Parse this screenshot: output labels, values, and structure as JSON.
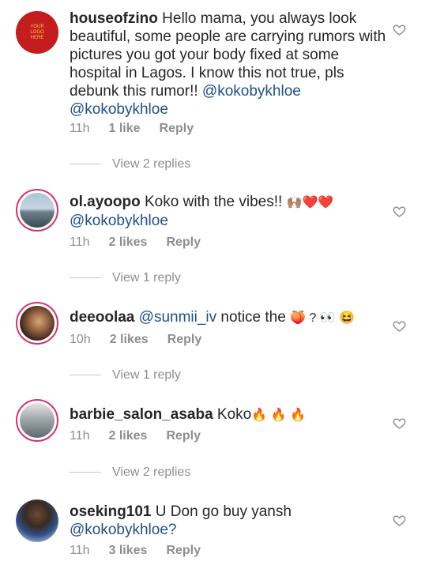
{
  "comments": [
    {
      "username": "houseofzino",
      "text": " Hello mama, you always look beautiful, some people are carrying rumors with pictures you got your body fixed at some hospital in Lagos. I know this not true, pls debunk this rumor!! ",
      "mention1": "@kokobykhloe",
      "mention2": "@kokobykhloe",
      "time": "11h",
      "likes": "1 like",
      "reply": "Reply",
      "view_replies": "View 2 replies",
      "avatar_text": "YOUR LOGO HERE"
    },
    {
      "username": "ol.ayoopo",
      "text": " Koko with the vibes!! ",
      "emoji": "🙌🏽❤️❤️",
      "mention": "@kokobykhloe",
      "time": "11h",
      "likes": "2 likes",
      "reply": "Reply",
      "view_replies": "View 1 reply"
    },
    {
      "username": "deeoolaa",
      "mention": "@sunmii_iv",
      "text": " notice the ",
      "emoji": "🍑 ? 👀 😆",
      "time": "10h",
      "likes": "2 likes",
      "reply": "Reply",
      "view_replies": "View 1 reply"
    },
    {
      "username": "barbie_salon_asaba",
      "text": " Koko",
      "emoji": "🔥 🔥 🔥",
      "time": "11h",
      "likes": "2 likes",
      "reply": "Reply",
      "view_replies": "View 2 replies"
    },
    {
      "username": "oseking101",
      "text": " U Don go buy yansh ",
      "mention": "@kokobykhloe?",
      "time": "11h",
      "likes": "3 likes",
      "reply": "Reply"
    }
  ],
  "colors": {
    "mention": "#1f4f8a",
    "meta": "#8e8e8e",
    "ring": "#d6336c"
  },
  "icons": {
    "like": "heart-outline-icon"
  }
}
